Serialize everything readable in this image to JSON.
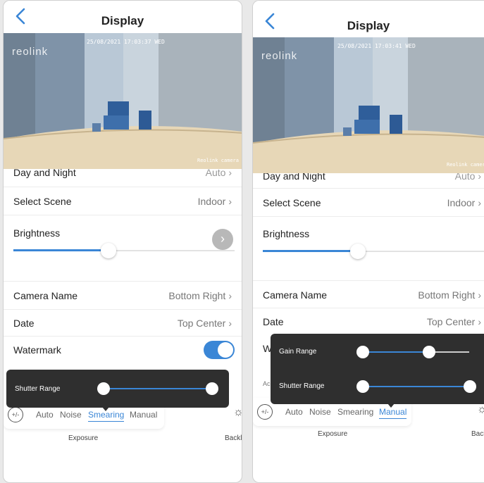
{
  "screens": [
    {
      "title": "Display",
      "video": {
        "timestamp": "25/08/2021 17:03:37 WED",
        "logo": "reolink",
        "camera_label": "Reolink camera"
      },
      "clipped_row": {
        "label": "Day and Night",
        "value": "Auto"
      },
      "select_scene": {
        "label": "Select Scene",
        "value": "Indoor"
      },
      "brightness": {
        "label": "Brightness",
        "level": 0.43
      },
      "camera_name": {
        "label": "Camera Name",
        "value": "Bottom Right"
      },
      "date": {
        "label": "Date",
        "value": "Top Center"
      },
      "watermark": {
        "label": "Watermark",
        "on": true
      },
      "popup": {
        "shutter_label": "Shutter Range"
      },
      "exposure_tabs": [
        "Auto",
        "Noise",
        "Smearing",
        "Manual"
      ],
      "active_tab": "Smearing",
      "exposure_caption": "Exposure",
      "backlight_caption": "Backli"
    },
    {
      "title": "Display",
      "video": {
        "timestamp": "25/08/2021 17:03:41 WED",
        "logo": "reolink",
        "camera_label": "Reolink camera"
      },
      "clipped_row": {
        "label": "Day and Night",
        "value": "Auto"
      },
      "select_scene": {
        "label": "Select Scene",
        "value": "Indoor"
      },
      "brightness": {
        "label": "Brightness",
        "level": 0.43
      },
      "camera_name": {
        "label": "Camera Name",
        "value": "Bottom Right"
      },
      "date": {
        "label": "Date",
        "value": "Top Center"
      },
      "watermark": {
        "label": "W"
      },
      "partial_label": "Ac",
      "popup": {
        "gain_label": "Gain Range",
        "shutter_label": "Shutter Range"
      },
      "exposure_tabs": [
        "Auto",
        "Noise",
        "Smearing",
        "Manual"
      ],
      "active_tab": "Manual",
      "exposure_caption": "Exposure",
      "backlight_caption": "Back"
    }
  ],
  "icons": {
    "back": "chevron-left-icon",
    "next": "chevron-right-icon",
    "exposure": "exposure-plus-minus-icon",
    "backlight": "backlight-sun-icon"
  },
  "colors": {
    "accent": "#3a86d6",
    "popup_bg": "#2f2f2f"
  }
}
